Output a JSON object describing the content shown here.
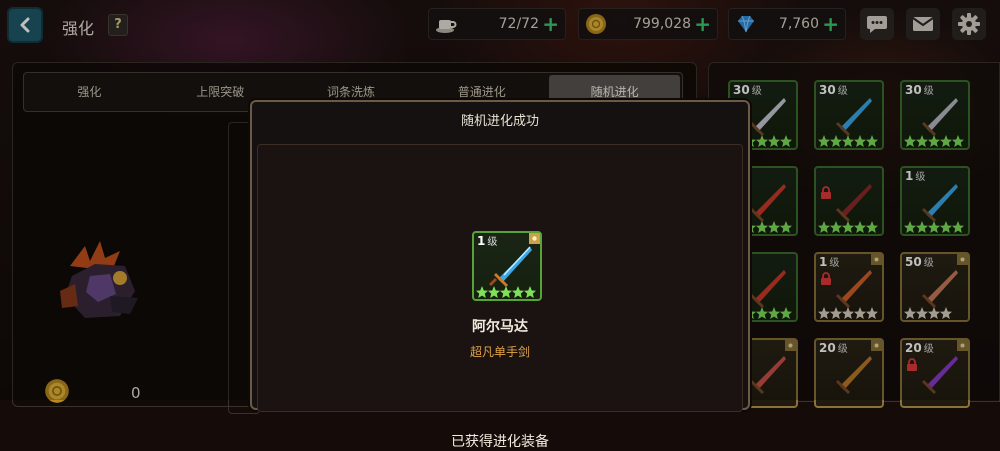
{
  "header": {
    "title": "强化",
    "help_label": "?",
    "stamina": "72/72",
    "gold": "799,028",
    "gems": "7,760"
  },
  "tabs": [
    {
      "label": "强化",
      "active": false
    },
    {
      "label": "上限突破",
      "active": false
    },
    {
      "label": "词条洗炼",
      "active": false
    },
    {
      "label": "普通进化",
      "active": false
    },
    {
      "label": "随机进化",
      "active": true
    }
  ],
  "left_panel": {
    "cost_value": "0"
  },
  "inventory": [
    {
      "level": "30",
      "unit": "级",
      "stars": 5,
      "locked": false,
      "rarity": "green"
    },
    {
      "level": "30",
      "unit": "级",
      "stars": 5,
      "locked": false,
      "rarity": "green"
    },
    {
      "level": "30",
      "unit": "级",
      "stars": 5,
      "locked": false,
      "rarity": "green"
    },
    {
      "level": "",
      "unit": "",
      "stars": 5,
      "locked": false,
      "rarity": "green"
    },
    {
      "level": "",
      "unit": "",
      "stars": 5,
      "locked": true,
      "rarity": "green"
    },
    {
      "level": "1",
      "unit": "级",
      "stars": 5,
      "locked": false,
      "rarity": "green"
    },
    {
      "level": "",
      "unit": "",
      "stars": 5,
      "locked": false,
      "rarity": "green"
    },
    {
      "level": "1",
      "unit": "级",
      "stars": 5,
      "locked": true,
      "rarity": "gold"
    },
    {
      "level": "50",
      "unit": "级",
      "stars": 4,
      "locked": false,
      "rarity": "gold"
    },
    {
      "level": "",
      "unit": "",
      "stars": 0,
      "locked": false,
      "rarity": "gold"
    },
    {
      "level": "20",
      "unit": "级",
      "stars": 0,
      "locked": false,
      "rarity": "gold"
    },
    {
      "level": "20",
      "unit": "级",
      "stars": 0,
      "locked": true,
      "rarity": "gold"
    }
  ],
  "modal": {
    "title": "随机进化成功",
    "item": {
      "level": "1",
      "unit": "级",
      "stars": 5,
      "name": "阿尔马达",
      "type": "超凡单手剑"
    },
    "footer": "已获得进化装备"
  },
  "colors": {
    "accent_green": "#3ccb6e",
    "gold_text": "#e0a44a",
    "back_button": "#1f5a6a"
  }
}
